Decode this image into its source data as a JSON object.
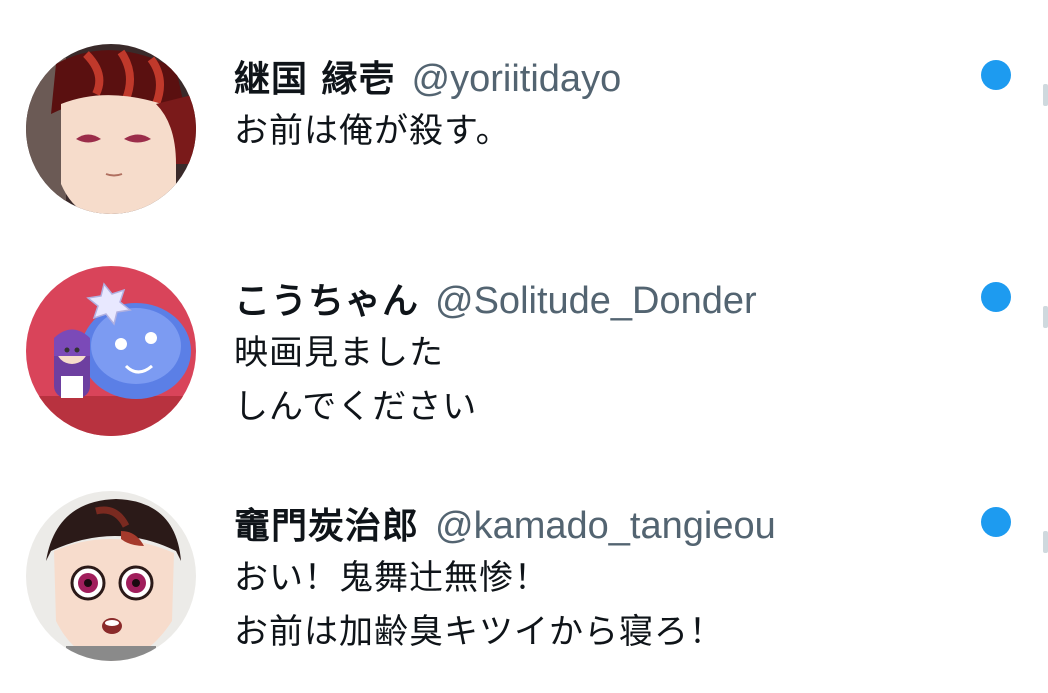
{
  "colors": {
    "unread_dot": "#1d9bf0",
    "name_text": "#0f1419",
    "handle_text": "#536471"
  },
  "conversations": [
    {
      "display_name": "継国 縁壱",
      "handle": "@yoriitidayo",
      "lines": [
        "お前は俺が殺す。"
      ],
      "avatar_icon": "anime-character-red-hair-avatar",
      "unread": true
    },
    {
      "display_name": "こうちゃん",
      "handle": "@Solitude_Donder",
      "lines": [
        "映画見ました",
        "しんでください"
      ],
      "avatar_icon": "blue-mascot-avatar",
      "unread": true
    },
    {
      "display_name": "竈門炭治郎",
      "handle": "@kamado_tangieou",
      "lines": [
        "おい！鬼舞辻無惨！",
        "お前は加齢臭キツイから寝ろ！"
      ],
      "avatar_icon": "anime-boy-avatar",
      "unread": true
    }
  ]
}
